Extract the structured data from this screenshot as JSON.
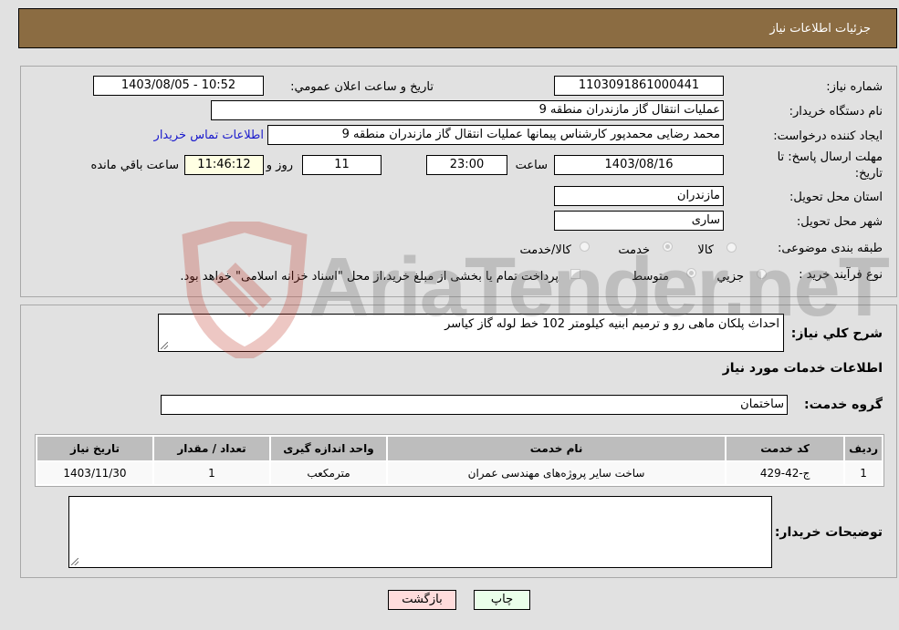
{
  "header": {
    "title": "جزئیات اطلاعات نیاز"
  },
  "fields": {
    "need_number": {
      "label": "شماره نیاز:",
      "value": "1103091861000441"
    },
    "announce_datetime": {
      "label": "تاریخ و ساعت اعلان عمومي:",
      "value": "1403/08/05 - 10:52"
    },
    "buyer_org": {
      "label": "نام دستگاه خریدار:",
      "value": "عملیات انتقال گاز مازندران منطقه 9"
    },
    "requester": {
      "label": "ایجاد کننده درخواست:",
      "value": "محمد رضایی محمدپور کارشناس پیمانها عملیات انتقال گاز مازندران منطقه 9"
    },
    "contact_link": "اطلاعات تماس خریدار",
    "deadline": {
      "label_line1": "مهلت ارسال پاسخ: تا",
      "label_line2": "تاریخ:",
      "date": "1403/08/16",
      "time_label": "ساعت",
      "time": "23:00",
      "days": "11",
      "days_label": "روز و",
      "remaining": "11:46:12",
      "remaining_label": "ساعت باقي مانده"
    },
    "province": {
      "label": "استان محل تحویل:",
      "value": "مازندران"
    },
    "city": {
      "label": "شهر محل تحویل:",
      "value": "ساری"
    },
    "category": {
      "label": "طبقه بندی موضوعی:",
      "options": [
        "کالا",
        "خدمت",
        "کالا/خدمت"
      ],
      "selected": "خدمت"
    },
    "process_type": {
      "label": "نوع فرآیند خرید :",
      "options": [
        "جزيي",
        "متوسط"
      ],
      "selected": "متوسط",
      "treasury_note": "پرداخت تمام یا بخشی از مبلغ خرید،از محل \"اسناد خزانه اسلامی\" خواهد بود."
    }
  },
  "description": {
    "label": "شرح كلي نياز:",
    "value": "احداث پلکان ماهی رو و ترمیم ابنیه کیلومتر 102 خط لوله گاز کیاسر"
  },
  "services_section": {
    "title": "اطلاعات خدمات مورد نیاز"
  },
  "service_group": {
    "label": "گروه خدمت:",
    "value": "ساختمان"
  },
  "table": {
    "columns": [
      "ردیف",
      "کد خدمت",
      "نام خدمت",
      "واحد اندازه گیری",
      "تعداد / مقدار",
      "تاریخ نیاز"
    ],
    "rows": [
      [
        "1",
        "ج-42-429",
        "ساخت سایر پروژه‌های مهندسی عمران",
        "مترمکعب",
        "1",
        "1403/11/30"
      ]
    ]
  },
  "buyer_notes": {
    "label": "توضیحات خریدار:",
    "value": ""
  },
  "buttons": {
    "print": "چاپ",
    "back": "بازگشت"
  },
  "watermark": {
    "text": "AriaTender.neT"
  }
}
